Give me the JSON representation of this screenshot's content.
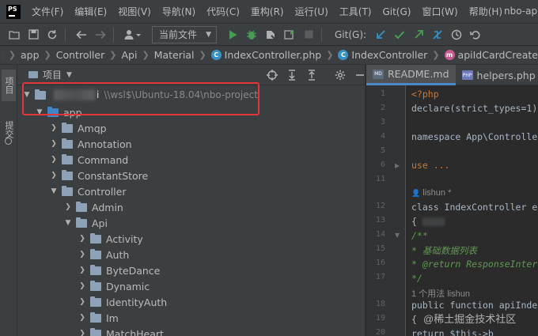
{
  "app": {
    "logo_text": "PS",
    "window_title": "nbo-ap"
  },
  "menu": [
    "文件(F)",
    "编辑(E)",
    "视图(V)",
    "导航(N)",
    "代码(C)",
    "重构(R)",
    "运行(U)",
    "工具(T)",
    "Git(G)",
    "窗口(W)",
    "帮助(H)"
  ],
  "toolbar": {
    "config_select": "当前文件",
    "git_label": "Git(G):",
    "icons": [
      "folder-open-icon",
      "save-icon",
      "sync-icon",
      "back-arrow-icon",
      "forward-arrow-icon",
      "user-icon",
      "run-icon",
      "debug-icon",
      "coverage-icon",
      "profile-icon",
      "stop-icon",
      "git-update-icon",
      "git-commit-icon",
      "git-push-icon",
      "git-branch-icon",
      "history-icon",
      "rollback-icon"
    ]
  },
  "breadcrumb": {
    "items": [
      "app",
      "Controller",
      "Api",
      "Material"
    ],
    "file": "IndexController.php",
    "class": "IndexController",
    "method": "apiIdCardCreate"
  },
  "tool_strip": {
    "project_tab": "项目",
    "commit_tab": "提交"
  },
  "project_panel": {
    "title": "项目",
    "root": {
      "suffix": "i",
      "path": "\\\\wsl$\\Ubuntu-18.04\\nbo-project"
    },
    "tree": [
      {
        "label": "app",
        "level": 1,
        "expanded": true,
        "color": "blue"
      },
      {
        "label": "Amqp",
        "level": 2,
        "expanded": false
      },
      {
        "label": "Annotation",
        "level": 2,
        "expanded": false
      },
      {
        "label": "Command",
        "level": 2,
        "expanded": false
      },
      {
        "label": "ConstantStore",
        "level": 2,
        "expanded": false
      },
      {
        "label": "Controller",
        "level": 2,
        "expanded": true
      },
      {
        "label": "Admin",
        "level": 3,
        "expanded": false
      },
      {
        "label": "Api",
        "level": 3,
        "expanded": true
      },
      {
        "label": "Activity",
        "level": 4,
        "expanded": false
      },
      {
        "label": "Auth",
        "level": 4,
        "expanded": false
      },
      {
        "label": "ByteDance",
        "level": 4,
        "expanded": false
      },
      {
        "label": "Dynamic",
        "level": 4,
        "expanded": false
      },
      {
        "label": "IdentityAuth",
        "level": 4,
        "expanded": false
      },
      {
        "label": "Im",
        "level": 4,
        "expanded": false
      },
      {
        "label": "MatchHeart",
        "level": 4,
        "expanded": false
      }
    ]
  },
  "editor": {
    "tabs": [
      {
        "label": "README.md",
        "icon": "MD",
        "active": true
      },
      {
        "label": "helpers.php",
        "icon": "PHP",
        "active": false
      }
    ],
    "lines": [
      {
        "num": "1",
        "code": "<?php"
      },
      {
        "num": "2",
        "code": "declare(strict_types=1);"
      },
      {
        "num": "3",
        "code": ""
      },
      {
        "num": "4",
        "code": "namespace App\\Controller\\Api\\Material;"
      },
      {
        "num": "5",
        "code": ""
      },
      {
        "num": "6",
        "code": "use ..."
      },
      {
        "num": "11",
        "code": ""
      },
      {
        "num": "",
        "code": "lishun *"
      },
      {
        "num": "12",
        "code": "class IndexController extends"
      },
      {
        "num": "13",
        "code": "{"
      },
      {
        "num": "14",
        "code": "    /**"
      },
      {
        "num": "15",
        "code": "     * 基础数据列表"
      },
      {
        "num": "16",
        "code": "     * @return ResponseInterface"
      },
      {
        "num": "17",
        "code": "     */"
      },
      {
        "num": "",
        "code": "1 个用法  lishun"
      },
      {
        "num": "18",
        "code": "    public function apiIndex()"
      },
      {
        "num": "19",
        "code": "    {"
      },
      {
        "num": "20",
        "code": "        return $this->b"
      }
    ]
  },
  "watermark": "@稀土掘金技术社区"
}
